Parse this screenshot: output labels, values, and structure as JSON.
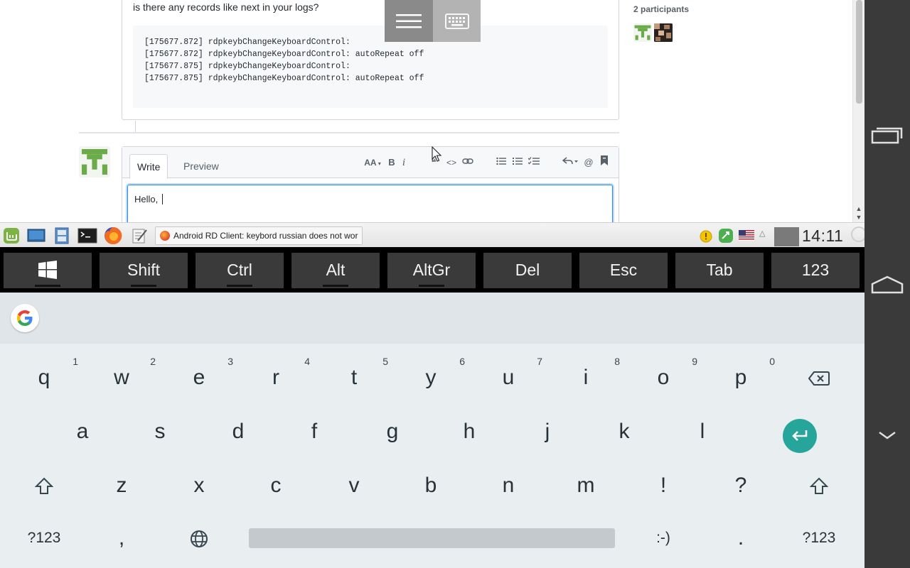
{
  "remote_page": {
    "comment_intro": "is there any records like next in your logs?",
    "log_lines": [
      "[175677.872] rdpkeybChangeKeyboardControl:",
      "[175677.872] rdpkeybChangeKeyboardControl: autoRepeat off",
      "[175677.875] rdpkeybChangeKeyboardControl:",
      "[175677.875] rdpkeybChangeKeyboardControl: autoRepeat off"
    ],
    "participants_label": "2 participants",
    "editor": {
      "tab_write": "Write",
      "tab_preview": "Preview",
      "toolbar": {
        "heading": "AA",
        "bold": "B",
        "italic": "i",
        "quote": "❝",
        "code": "<>",
        "link": "🔗",
        "bullets": "☰",
        "numbered": "☷",
        "tasks": "☑",
        "reply": "↶",
        "mention": "@",
        "bookmark": "🔖"
      },
      "text_value": "Hello, "
    }
  },
  "taskbar": {
    "window_title": "Android RD Client: keybord russian does not wor",
    "clock": "14:11"
  },
  "extra_keys": [
    "Shift",
    "Ctrl",
    "Alt",
    "AltGr",
    "Del",
    "Esc",
    "Tab",
    "123"
  ],
  "keyboard": {
    "row1": [
      {
        "key": "q",
        "hint": "1"
      },
      {
        "key": "w",
        "hint": "2"
      },
      {
        "key": "e",
        "hint": "3"
      },
      {
        "key": "r",
        "hint": "4"
      },
      {
        "key": "t",
        "hint": "5"
      },
      {
        "key": "y",
        "hint": "6"
      },
      {
        "key": "u",
        "hint": "7"
      },
      {
        "key": "i",
        "hint": "8"
      },
      {
        "key": "o",
        "hint": "9"
      },
      {
        "key": "p",
        "hint": "0"
      }
    ],
    "row2": [
      "a",
      "s",
      "d",
      "f",
      "g",
      "h",
      "j",
      "k",
      "l"
    ],
    "row3": [
      "z",
      "x",
      "c",
      "v",
      "b",
      "n",
      "m",
      "!",
      "?"
    ],
    "row4": {
      "symbols_left": "?123",
      "comma": ",",
      "emoticon": ":-)",
      "period": ".",
      "symbols_right": "?123"
    }
  },
  "colors": {
    "accent_teal": "#26a69a",
    "navbar": "#3a3a3a",
    "extra_key": "#3a3a3a",
    "keyboard_bg": "#e9eef1",
    "focus_blue": "#2188ff"
  }
}
